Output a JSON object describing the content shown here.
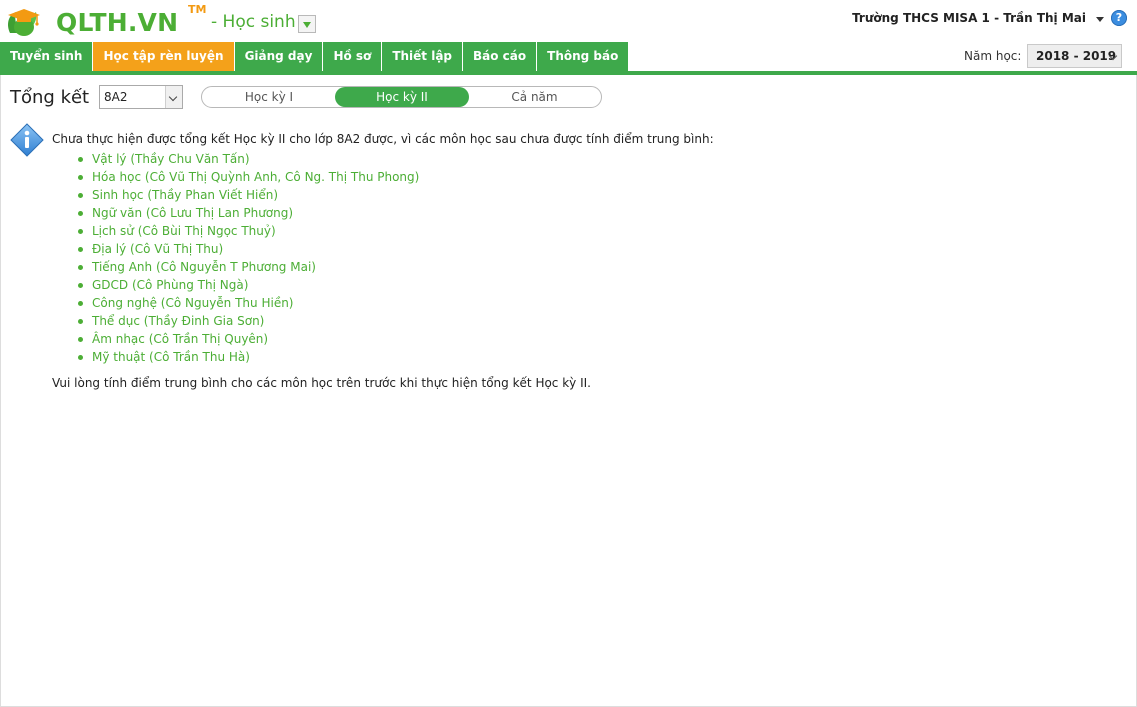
{
  "header": {
    "logo_text": "QLTH.VN",
    "logo_tm": "TM",
    "module": "- Học sinh",
    "user": "Trường THCS MISA 1 - Trần Thị Mai",
    "help": "?"
  },
  "nav": {
    "tabs": [
      {
        "label": "Tuyển sinh"
      },
      {
        "label": "Học tập rèn luyện"
      },
      {
        "label": "Giảng dạy"
      },
      {
        "label": "Hồ sơ"
      },
      {
        "label": "Thiết lập"
      },
      {
        "label": "Báo cáo"
      },
      {
        "label": "Thông báo"
      }
    ],
    "active_tab": "Học tập rèn luyện",
    "year_label": "Năm học:",
    "year_value": "2018 - 2019"
  },
  "content": {
    "title": "Tổng kết",
    "class_value": "8A2",
    "terms": [
      {
        "label": "Học kỳ I"
      },
      {
        "label": "Học kỳ II"
      },
      {
        "label": "Cả năm"
      }
    ],
    "active_term": "Học kỳ II",
    "message": "Chưa thực hiện được tổng kết Học kỳ II cho lớp 8A2 được, vì các môn học sau chưa được tính điểm trung bình:",
    "subjects": [
      "Vật lý (Thầy Chu Văn Tấn)",
      "Hóa học (Cô Vũ Thị Quỳnh Anh, Cô Ng. Thị Thu Phong)",
      "Sinh học (Thầy Phan Viết Hiển)",
      "Ngữ văn (Cô Lưu Thị Lan Phương)",
      "Lịch sử (Cô Bùi Thị Ngọc Thuỷ)",
      "Địa lý (Cô Vũ Thị Thu)",
      "Tiếng Anh (Cô Nguyễn T Phương Mai)",
      "GDCD (Cô Phùng Thị Ngà)",
      "Công nghệ (Cô Nguyễn Thu Hiền)",
      "Thể dục (Thầy Đinh Gia Sơn)",
      "Âm nhạc (Cô Trần Thị Quyên)",
      "Mỹ thuật (Cô Trần Thu Hà)"
    ],
    "footer": "Vui lòng tính điểm trung bình cho các môn học trên trước khi thực hiện tổng kết Học kỳ II."
  },
  "colors": {
    "brand_green": "#4cae35",
    "nav_green": "#3ea94b",
    "active_orange": "#f4a11a",
    "info_blue": "#3b8de0"
  }
}
